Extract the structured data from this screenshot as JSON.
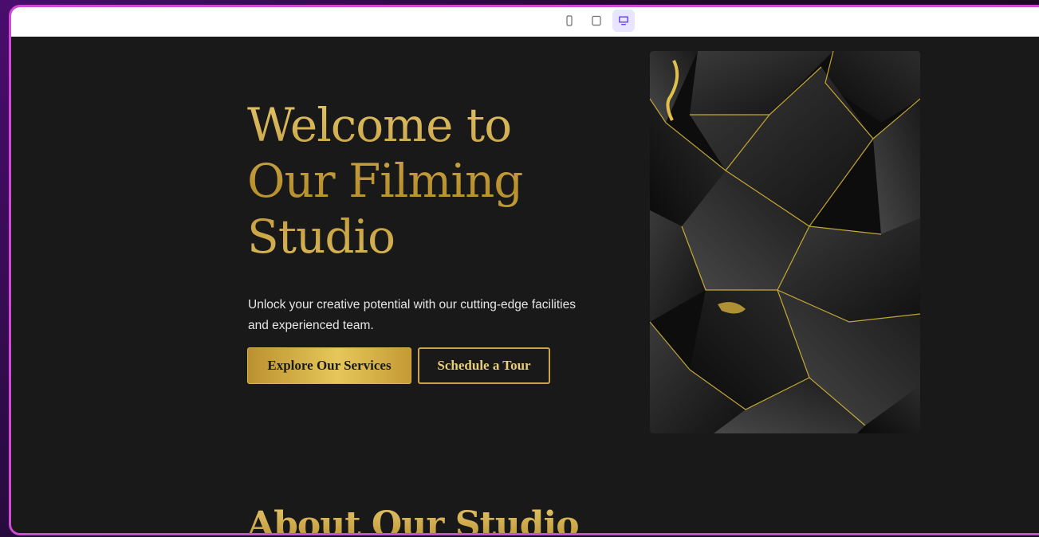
{
  "toolbar": {
    "devices": [
      {
        "icon": "mobile-icon",
        "active": false
      },
      {
        "icon": "tablet-icon",
        "active": false
      },
      {
        "icon": "desktop-icon",
        "active": true
      }
    ]
  },
  "hero": {
    "title": "Welcome to Our Filming Studio",
    "subtitle": "Unlock your creative potential with our cutting-edge facilities and experienced team.",
    "primary_button": "Explore Our Services",
    "secondary_button": "Schedule a Tour",
    "image_icon": "abstract-gold-black-geometric-image"
  },
  "about": {
    "title": "About Our Studio"
  },
  "colors": {
    "accent_gold": "#d4b04a",
    "background": "#191919",
    "frame_border": "#d04ad6",
    "active_device": "#6b46ff"
  }
}
